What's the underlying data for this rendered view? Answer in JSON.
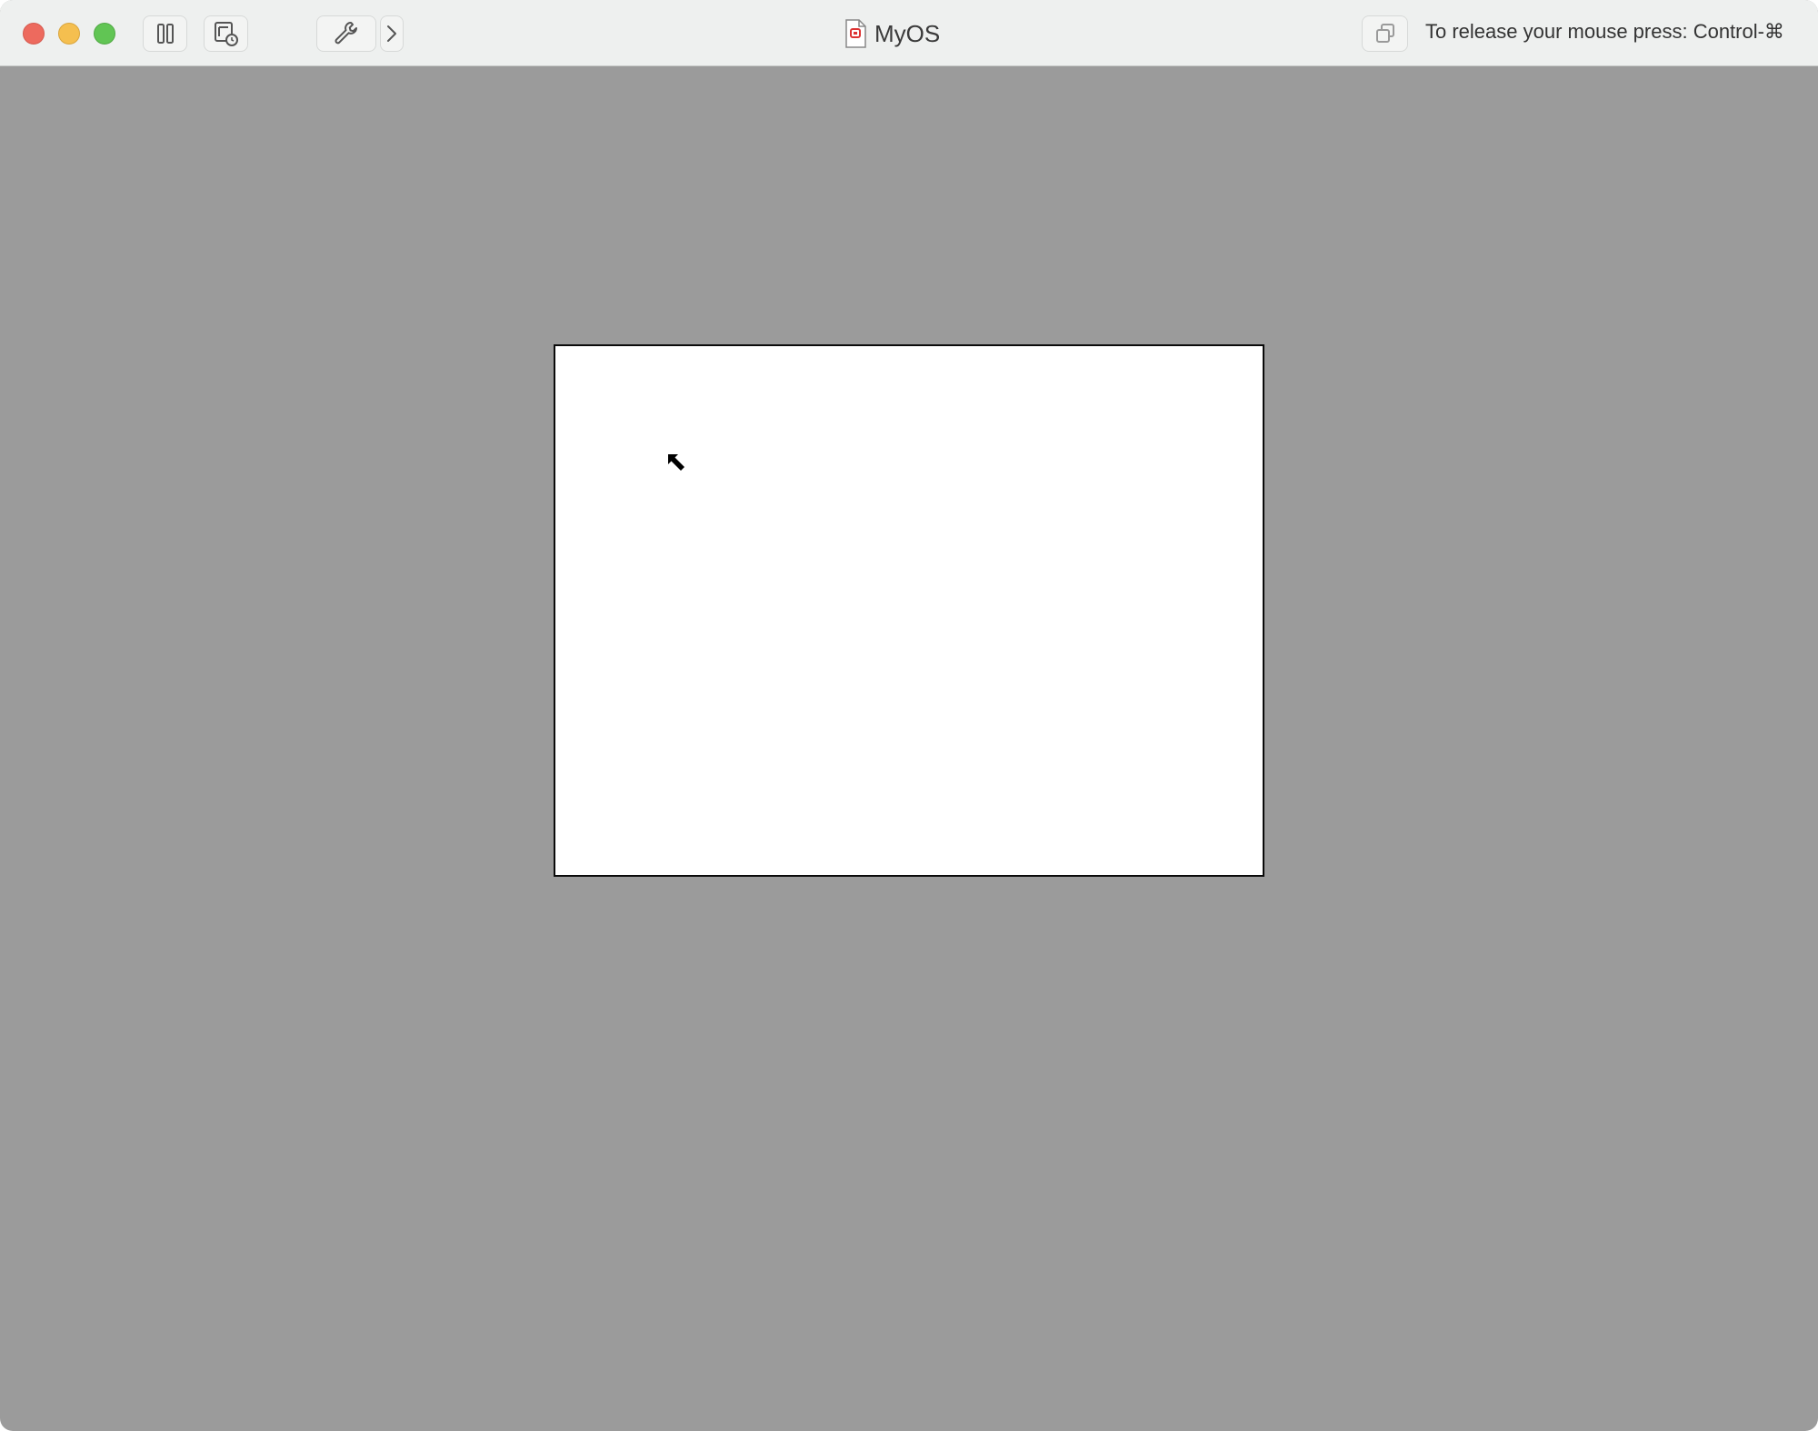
{
  "window": {
    "title": "MyOS",
    "release_hint": "To release your mouse press: Control-⌘"
  },
  "toolbar": {
    "buttons": [
      {
        "name": "pause",
        "icon": "pause-icon"
      },
      {
        "name": "snapshot",
        "icon": "snapshot-icon"
      },
      {
        "name": "settings",
        "icon": "wrench-icon"
      },
      {
        "name": "more",
        "icon": "chevron-right-icon"
      },
      {
        "name": "display",
        "icon": "display-icon"
      }
    ]
  },
  "colors": {
    "vm_background": "#9b9b9b",
    "titlebar": "#eef0ef",
    "close": "#ed6a5e",
    "minimize": "#f5bf4f",
    "zoom": "#61c554",
    "guest_screen": "#ffffff"
  }
}
